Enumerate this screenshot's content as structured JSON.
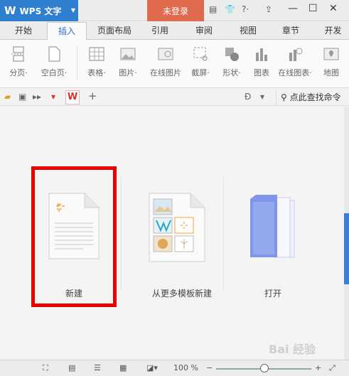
{
  "titlebar": {
    "app_name": "WPS 文字",
    "login_label": "未登录"
  },
  "tabs": [
    {
      "label": "开始"
    },
    {
      "label": "插入"
    },
    {
      "label": "页面布局"
    },
    {
      "label": "引用"
    },
    {
      "label": "审阅"
    },
    {
      "label": "视图"
    },
    {
      "label": "章节"
    },
    {
      "label": "开发"
    }
  ],
  "active_tab": "插入",
  "ribbon": [
    {
      "label": "分页·",
      "icon": "page-break-icon"
    },
    {
      "label": "空白页·",
      "icon": "blank-page-icon"
    },
    {
      "label": "表格·",
      "icon": "table-icon"
    },
    {
      "label": "图片·",
      "icon": "picture-icon"
    },
    {
      "label": "在线图片",
      "icon": "online-picture-icon"
    },
    {
      "label": "截屏·",
      "icon": "screenshot-icon"
    },
    {
      "label": "形状·",
      "icon": "shape-icon"
    },
    {
      "label": "图表",
      "icon": "chart-icon"
    },
    {
      "label": "在线图表·",
      "icon": "online-chart-icon"
    },
    {
      "label": "地图",
      "icon": "map-icon"
    }
  ],
  "quickbar": {
    "search_command": "点此查找命令"
  },
  "main": {
    "new_label": "新建",
    "template_label": "从更多模板新建",
    "open_label": "打开"
  },
  "status": {
    "zoom": "100 %"
  },
  "watermark": "Bai 经验"
}
